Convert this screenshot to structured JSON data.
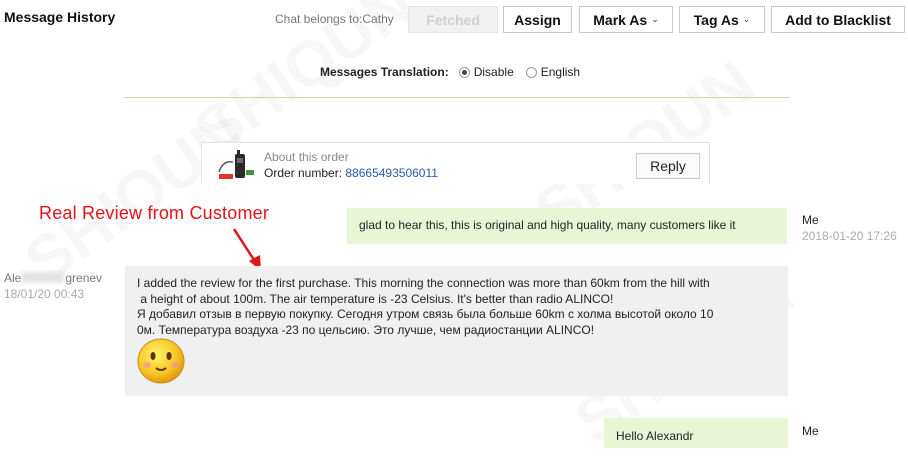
{
  "header": {
    "title": "Message History",
    "chat_owner": "Chat belongs to:Cathy",
    "buttons": {
      "fetched": "Fetched",
      "assign": "Assign",
      "mark_as": "Mark As",
      "tag_as": "Tag As",
      "blacklist": "Add to Blacklist"
    }
  },
  "translation": {
    "label": "Messages Translation:",
    "options": [
      "Disable",
      "English"
    ],
    "selected": "Disable"
  },
  "order": {
    "about": "About this order",
    "number_label": "Order number:",
    "number": "88665493506011",
    "reply_label": "Reply"
  },
  "annotation": "Real Review from Customer",
  "messages": [
    {
      "sender": "Me",
      "time": "2018-01-20 17:26",
      "text": "glad to hear this, this is original and high quality, many customers like it"
    },
    {
      "sender_first": "Ale",
      "sender_last": "grenev",
      "time": "18/01/20 00:43",
      "lines": [
        "I added the review for the first purchase. This morning the connection was more than 60km from the hill with",
        " a height of about 100m. The air temperature is -23 Celsius. It's better than radio ALINCO!",
        "Я добавил отзыв в первую покупку. Сегодня утром связь была больше 60km с холма высотой около 10",
        "0м. Температура воздуха -23 по цельсию. Это лучше, чем радиостанции ALINCO!"
      ]
    },
    {
      "sender": "Me",
      "text": "Hello Alexandr"
    }
  ],
  "colors": {
    "accent_link": "#2a5caa",
    "annotation": "#e1141c",
    "my_bubble": "#e9f6d6",
    "customer_bubble": "#f0f0f0"
  }
}
